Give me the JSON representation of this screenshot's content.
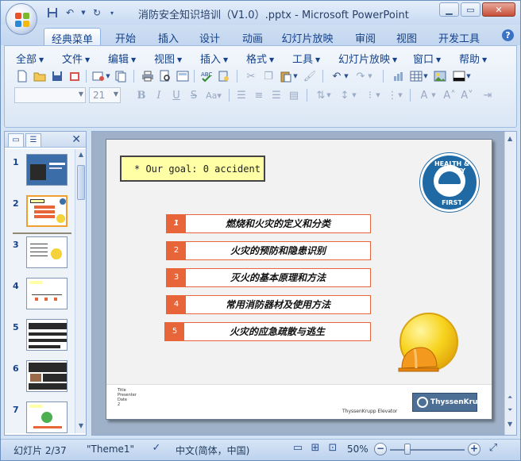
{
  "window": {
    "title": "消防安全知识培训（V1.0）.pptx - Microsoft PowerPoint"
  },
  "quick_access": [
    "save-icon",
    "undo-icon",
    "redo-icon",
    "customize-icon"
  ],
  "ribbon_tabs": [
    {
      "label": "经典菜单",
      "active": true
    },
    {
      "label": "开始"
    },
    {
      "label": "插入"
    },
    {
      "label": "设计"
    },
    {
      "label": "动画"
    },
    {
      "label": "幻灯片放映"
    },
    {
      "label": "审阅"
    },
    {
      "label": "视图"
    },
    {
      "label": "开发工具"
    }
  ],
  "menus": [
    "全部",
    "文件",
    "编辑",
    "视图",
    "插入",
    "格式",
    "工具",
    "幻灯片放映",
    "窗口",
    "帮助"
  ],
  "format_bar": {
    "font_name": "",
    "font_size": "21"
  },
  "thumbnails": [
    {
      "num": "1"
    },
    {
      "num": "2"
    },
    {
      "num": "3"
    },
    {
      "num": "4"
    },
    {
      "num": "5"
    },
    {
      "num": "6"
    },
    {
      "num": "7"
    }
  ],
  "slide": {
    "goal": "* Our goal: 0 accident",
    "badge_top": "HEALTH & SAFETY",
    "badge_bottom": "FIRST",
    "agenda": [
      {
        "num": "1",
        "label": "燃烧和火灾的定义和分类"
      },
      {
        "num": "2",
        "label": "火灾的预防和隐患识别"
      },
      {
        "num": "3",
        "label": "灭火的基本原理和方法"
      },
      {
        "num": "4",
        "label": "常用消防器材及使用方法"
      },
      {
        "num": "5",
        "label": "火灾的应急疏散与逃生"
      }
    ],
    "footer_lines": [
      "Title",
      "Presenter",
      "Date",
      "2"
    ],
    "footer_brand": "ThyssenKrupp Elevator",
    "logo_text": "ThyssenKrupp"
  },
  "status": {
    "slide_count": "幻灯片 2/37",
    "theme": "\"Theme1\"",
    "language": "中文(简体，中国)",
    "zoom": "50%"
  },
  "colors": {
    "accent_orange": "#e8653a",
    "goal_yellow": "#ffffa6",
    "badge_blue": "#1f6aa5"
  }
}
